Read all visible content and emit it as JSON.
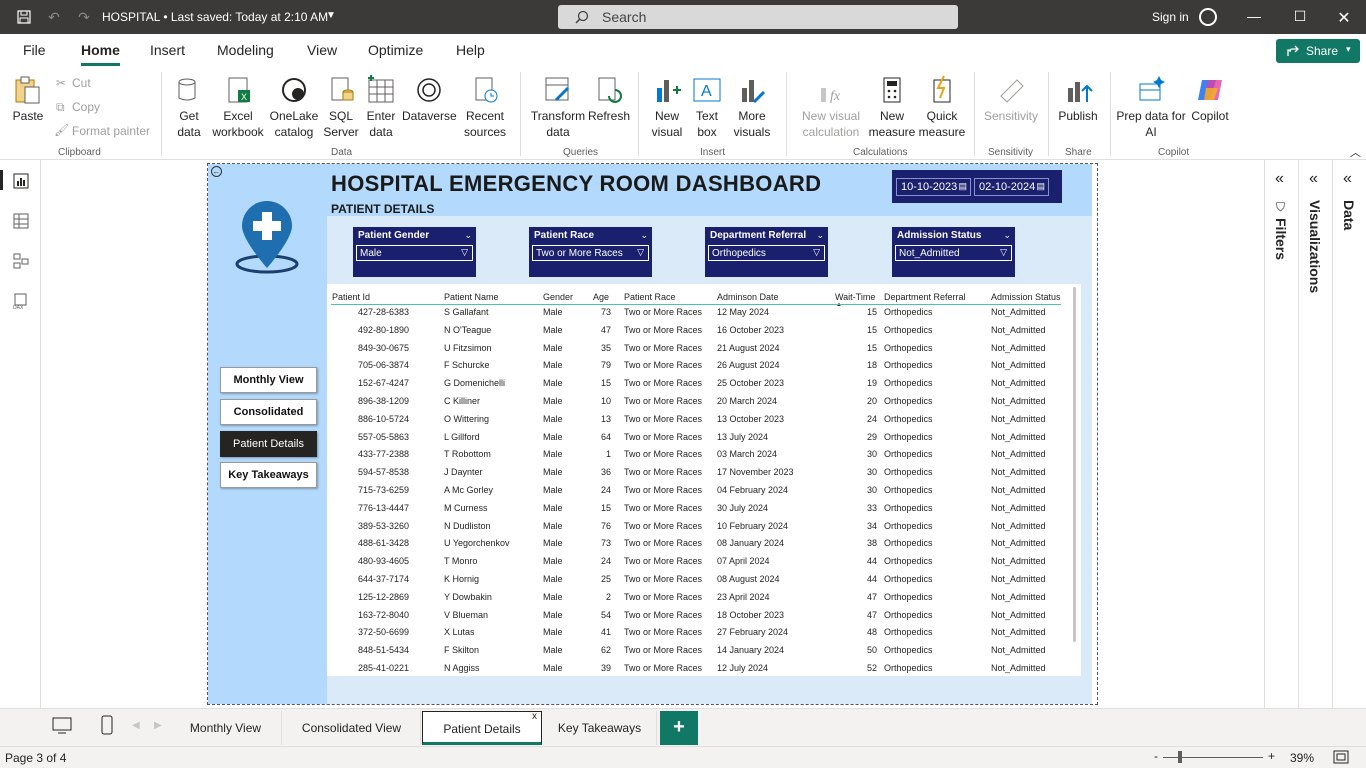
{
  "titlebar": {
    "title": "HOSPITAL • Last saved: Today at 2:10 AM",
    "search_placeholder": "Search",
    "sign_in": "Sign in"
  },
  "menu": {
    "tabs": [
      "File",
      "Home",
      "Insert",
      "Modeling",
      "View",
      "Optimize",
      "Help"
    ],
    "active": "Home",
    "share": "Share"
  },
  "ribbon": {
    "paste": "Paste",
    "cut": "Cut",
    "copy": "Copy",
    "format_painter": "Format painter",
    "get_data": "Get data",
    "excel": "Excel workbook",
    "onelake": "OneLake catalog",
    "sql": "SQL Server",
    "enter_data": "Enter data",
    "dataverse": "Dataverse",
    "recent": "Recent sources",
    "transform": "Transform data",
    "refresh": "Refresh",
    "new_visual": "New visual",
    "text_box": "Text box",
    "more_visuals": "More visuals",
    "new_visual_calc": "New visual calculation",
    "new_measure": "New measure",
    "quick_measure": "Quick measure",
    "sensitivity": "Sensitivity",
    "publish": "Publish",
    "prep_copilot": "Prep data for AI",
    "copilot": "Copilot",
    "groups": {
      "clipboard": "Clipboard",
      "data": "Data",
      "queries": "Queries",
      "insert": "Insert",
      "calculations": "Calculations",
      "sensitivity": "Sensitivity",
      "share": "Share",
      "copilot": "Copilot"
    }
  },
  "dashboard": {
    "title": "HOSPITAL EMERGENCY ROOM DASHBOARD",
    "subtitle": "PATIENT DETAILS",
    "date_from": "10-10-2023",
    "date_to": "02-10-2024",
    "nav_buttons": [
      "Monthly View",
      "Consolidated View",
      "Patient Details",
      "Key Takeaways"
    ],
    "active_nav": "Patient Details",
    "slicers": [
      {
        "label": "Patient Gender",
        "value": "Male"
      },
      {
        "label": "Patient Race",
        "value": "Two or More Races"
      },
      {
        "label": "Department Referral",
        "value": "Orthopedics"
      },
      {
        "label": "Admission Status",
        "value": "Not_Admitted"
      }
    ],
    "columns": [
      "Patient Id",
      "Patient Name",
      "Gender",
      "Age",
      "Patient Race",
      "Adminson Date",
      "Wait-Time",
      "Department Referral",
      "Admission Status"
    ],
    "rows": [
      [
        "427-28-6383",
        "S Gallafant",
        "Male",
        "73",
        "Two or More Races",
        "12 May 2024",
        "15",
        "Orthopedics",
        "Not_Admitted"
      ],
      [
        "492-80-1890",
        "N O'Teague",
        "Male",
        "47",
        "Two or More Races",
        "16 October 2023",
        "15",
        "Orthopedics",
        "Not_Admitted"
      ],
      [
        "849-30-0675",
        "U Fitzsimon",
        "Male",
        "35",
        "Two or More Races",
        "21 August 2024",
        "15",
        "Orthopedics",
        "Not_Admitted"
      ],
      [
        "705-06-3874",
        "F Schurcke",
        "Male",
        "79",
        "Two or More Races",
        "26 August 2024",
        "18",
        "Orthopedics",
        "Not_Admitted"
      ],
      [
        "152-67-4247",
        "G Domenichelli",
        "Male",
        "15",
        "Two or More Races",
        "25 October 2023",
        "19",
        "Orthopedics",
        "Not_Admitted"
      ],
      [
        "896-38-1209",
        "C Killiner",
        "Male",
        "10",
        "Two or More Races",
        "20 March 2024",
        "20",
        "Orthopedics",
        "Not_Admitted"
      ],
      [
        "886-10-5724",
        "O Wittering",
        "Male",
        "13",
        "Two or More Races",
        "13 October 2023",
        "24",
        "Orthopedics",
        "Not_Admitted"
      ],
      [
        "557-05-5863",
        "L Gillford",
        "Male",
        "64",
        "Two or More Races",
        "13 July 2024",
        "29",
        "Orthopedics",
        "Not_Admitted"
      ],
      [
        "433-77-2388",
        "T Robottom",
        "Male",
        "1",
        "Two or More Races",
        "03 March 2024",
        "30",
        "Orthopedics",
        "Not_Admitted"
      ],
      [
        "594-57-8538",
        "J Daynter",
        "Male",
        "36",
        "Two or More Races",
        "17 November 2023",
        "30",
        "Orthopedics",
        "Not_Admitted"
      ],
      [
        "715-73-6259",
        "A Mc Gorley",
        "Male",
        "24",
        "Two or More Races",
        "04 February 2024",
        "30",
        "Orthopedics",
        "Not_Admitted"
      ],
      [
        "776-13-4447",
        "M Curness",
        "Male",
        "15",
        "Two or More Races",
        "30 July 2024",
        "33",
        "Orthopedics",
        "Not_Admitted"
      ],
      [
        "389-53-3260",
        "N Dudliston",
        "Male",
        "76",
        "Two or More Races",
        "10 February 2024",
        "34",
        "Orthopedics",
        "Not_Admitted"
      ],
      [
        "488-61-3428",
        "U Yegorchenkov",
        "Male",
        "73",
        "Two or More Races",
        "08 January 2024",
        "38",
        "Orthopedics",
        "Not_Admitted"
      ],
      [
        "480-93-4605",
        "T Monro",
        "Male",
        "24",
        "Two or More Races",
        "07 April 2024",
        "44",
        "Orthopedics",
        "Not_Admitted"
      ],
      [
        "644-37-7174",
        "K Hornig",
        "Male",
        "25",
        "Two or More Races",
        "08 August 2024",
        "44",
        "Orthopedics",
        "Not_Admitted"
      ],
      [
        "125-12-2869",
        "Y Dowbakin",
        "Male",
        "2",
        "Two or More Races",
        "23 April 2024",
        "47",
        "Orthopedics",
        "Not_Admitted"
      ],
      [
        "163-72-8040",
        "V Blueman",
        "Male",
        "54",
        "Two or More Races",
        "18 October 2023",
        "47",
        "Orthopedics",
        "Not_Admitted"
      ],
      [
        "372-50-6699",
        "X Lutas",
        "Male",
        "41",
        "Two or More Races",
        "27 February 2024",
        "48",
        "Orthopedics",
        "Not_Admitted"
      ],
      [
        "848-51-5434",
        "F Skilton",
        "Male",
        "62",
        "Two or More Races",
        "14 January 2024",
        "50",
        "Orthopedics",
        "Not_Admitted"
      ],
      [
        "285-41-0221",
        "N Aggiss",
        "Male",
        "39",
        "Two or More Races",
        "12 July 2024",
        "52",
        "Orthopedics",
        "Not_Admitted"
      ]
    ]
  },
  "right_panes": [
    "Filters",
    "Visualizations",
    "Data"
  ],
  "page_tabs": [
    "Monthly View",
    "Consolidated View",
    "Patient Details",
    "Key Takeaways"
  ],
  "active_page_tab": "Patient Details",
  "status": {
    "page": "Page 3 of 4",
    "zoom": "39%"
  },
  "colors": {
    "accent": "#117865",
    "panel_blue": "#b3d9fc",
    "slicer_navy": "#1a1f6e"
  }
}
